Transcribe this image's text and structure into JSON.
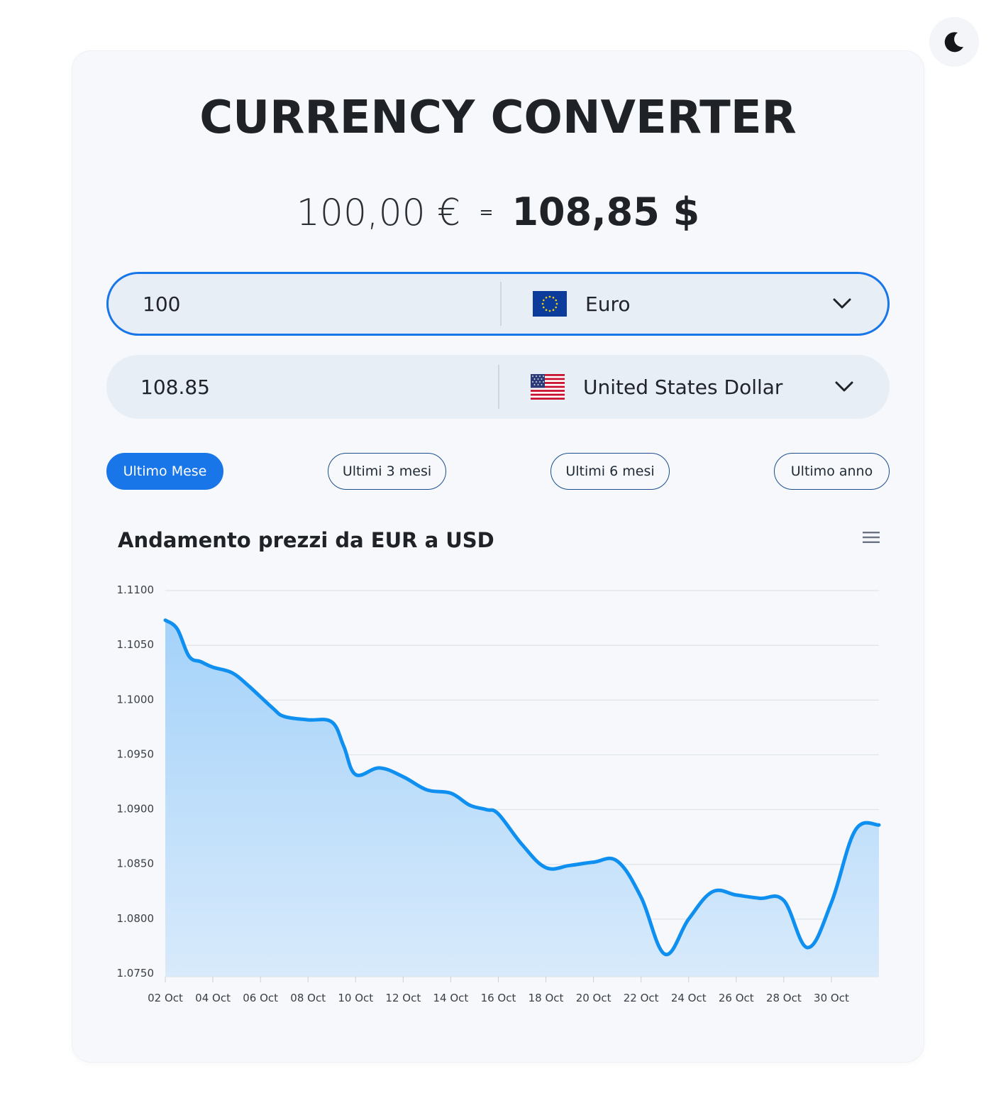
{
  "header": {
    "title": "CURRENCY CONVERTER",
    "theme_icon": "moon-icon"
  },
  "result": {
    "from_text": "100,00 €",
    "equals": "=",
    "to_text": "108,85 $"
  },
  "converter": {
    "source": {
      "amount": "100",
      "currency": "Euro",
      "flag": "eu-flag-icon"
    },
    "target": {
      "amount": "108.85",
      "currency": "United States Dollar",
      "flag": "us-flag-icon"
    }
  },
  "periods": [
    {
      "label": "Ultimo Mese",
      "selected": true
    },
    {
      "label": "Ultimi 3 mesi",
      "selected": false
    },
    {
      "label": "Ultimi 6 mesi",
      "selected": false
    },
    {
      "label": "Ultimo anno",
      "selected": false
    }
  ],
  "colors": {
    "accent": "#1976e8",
    "line": "#0f8ff0",
    "area_top": "#a4d2fa",
    "area_bottom": "#d8eafb"
  },
  "chart_data": {
    "type": "area",
    "title": "Andamento prezzi da EUR a USD",
    "xlabel": "",
    "ylabel": "",
    "ylim": [
      1.075,
      1.11
    ],
    "y_ticks": [
      "1.1100",
      "1.1050",
      "1.1000",
      "1.0950",
      "1.0900",
      "1.0850",
      "1.0800",
      "1.0750"
    ],
    "x_tick_labels": [
      "02 Oct",
      "04 Oct",
      "06 Oct",
      "08 Oct",
      "10 Oct",
      "12 Oct",
      "14 Oct",
      "16 Oct",
      "18 Oct",
      "20 Oct",
      "22 Oct",
      "24 Oct",
      "26 Oct",
      "28 Oct",
      "30 Oct"
    ],
    "x_days": [
      2,
      2.5,
      3,
      3.5,
      4,
      4.8,
      5.5,
      6.5,
      7,
      8,
      9,
      9.5,
      10,
      11,
      12,
      13,
      14,
      14.8,
      15.5,
      16,
      17,
      18,
      19,
      20,
      21,
      22,
      23,
      24,
      25,
      26,
      27,
      28,
      29,
      30,
      31
    ],
    "series": [
      {
        "values": [
          1.1073,
          1.1065,
          1.104,
          1.1035,
          1.103,
          1.1025,
          1.1013,
          1.0993,
          1.0985,
          1.0982,
          1.098,
          1.0958,
          1.0932,
          1.0938,
          1.093,
          1.0918,
          1.0915,
          1.0904,
          1.09,
          1.0896,
          1.0868,
          1.0847,
          1.0849,
          1.0852,
          1.0853,
          1.082,
          1.0768,
          1.08,
          1.0825,
          1.0822,
          1.0819,
          1.0817,
          1.0774,
          1.0815,
          1.0881
        ]
      }
    ],
    "last_point": {
      "x": 32,
      "y": 1.0886
    },
    "grid": true,
    "legend": "none"
  }
}
